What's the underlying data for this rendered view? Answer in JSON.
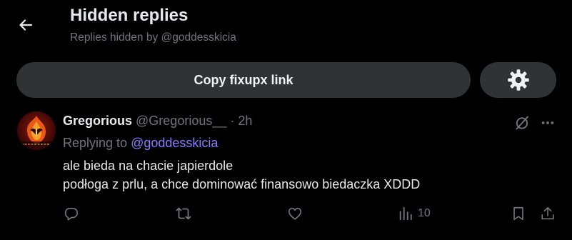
{
  "header": {
    "title": "Hidden replies",
    "subtitle": "Replies hidden by @goddesskicia"
  },
  "toolbar": {
    "copy_label": "Copy fixupx link"
  },
  "tweet": {
    "display_name": "Gregorious",
    "handle": "@Gregorious__",
    "separator": "·",
    "time": "2h",
    "replying_to_prefix": "Replying to",
    "replying_to_handle": "@goddesskicia",
    "lines": [
      "ale bieda na chacie japierdole",
      "podłoga z prlu, a chce dominować finansowo biedaczka XDDD"
    ],
    "views": "10"
  },
  "icons": {
    "back": "arrow-left-icon",
    "settings": "gear-icon",
    "hide": "hidden-reply-icon",
    "more": "more-icon",
    "reply": "reply-icon",
    "retweet": "retweet-icon",
    "like": "heart-icon",
    "views": "views-icon",
    "bookmark": "bookmark-icon",
    "share": "share-icon"
  },
  "colors": {
    "background": "#000000",
    "text": "#e7e9ea",
    "muted": "#71767b",
    "button": "#2f3336",
    "mention": "#8b7bff"
  }
}
